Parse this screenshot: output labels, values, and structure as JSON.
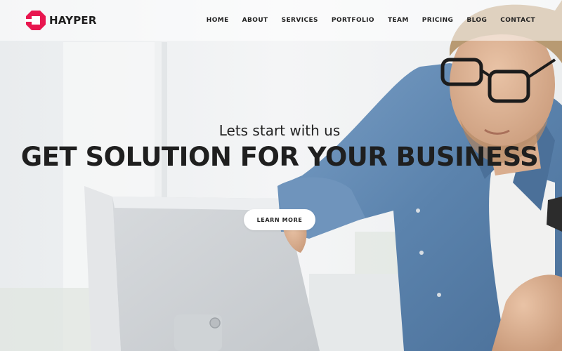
{
  "brand": {
    "name": "HAYPER",
    "color": "#e8164f"
  },
  "nav": {
    "items": [
      {
        "label": "HOME"
      },
      {
        "label": "ABOUT"
      },
      {
        "label": "SERVICES"
      },
      {
        "label": "PORTFOLIO"
      },
      {
        "label": "TEAM"
      },
      {
        "label": "PRICING"
      },
      {
        "label": "BLOG"
      },
      {
        "label": "CONTACT"
      }
    ]
  },
  "hero": {
    "subtitle": "Lets start with us",
    "title": "GET SOLUTION FOR YOUR BUSINESS",
    "cta_label": "LEARN MORE"
  },
  "colors": {
    "accent": "#e8164f",
    "text": "#1f1f1f",
    "denim": "#5e86b0"
  }
}
